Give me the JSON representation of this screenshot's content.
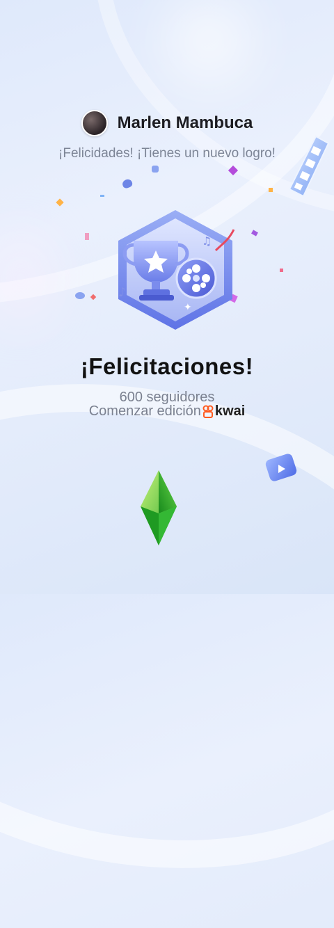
{
  "user": {
    "name": "Marlen Mambuca",
    "achievement_text": "¡Felicidades! ¡Tienes un nuevo logro!"
  },
  "badge": {
    "icons": [
      "trophy-icon",
      "star-icon",
      "film-reel-icon"
    ]
  },
  "main": {
    "title": "¡Felicitaciones!",
    "followers": "600 seguidores",
    "start_text": "Comenzar edición",
    "brand": "kwai"
  },
  "colors": {
    "accent": "#6d7ff0",
    "brand": "#ff5a1f",
    "gem": "#39c43a"
  }
}
